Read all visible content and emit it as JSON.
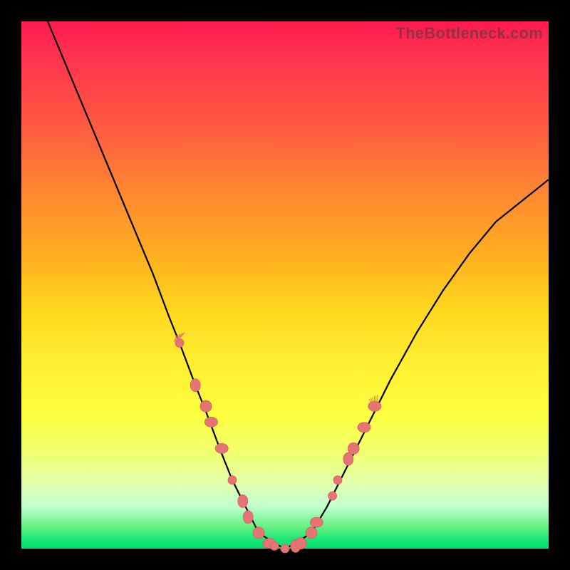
{
  "watermark": "TheBottleneck.com",
  "chart_data": {
    "type": "line",
    "title": "",
    "xlabel": "",
    "ylabel": "",
    "xlim": [
      0,
      100
    ],
    "ylim": [
      0,
      100
    ],
    "grid": false,
    "legend": false,
    "background_gradient": {
      "top_color": "#ff1a4d",
      "bottom_color": "#00e068",
      "description": "vertical red-to-green heat gradient"
    },
    "series": [
      {
        "name": "curve",
        "color": "#000000",
        "x": [
          5,
          10,
          15,
          20,
          25,
          28,
          30,
          33,
          35,
          38,
          40,
          43,
          45,
          48,
          50,
          52,
          55,
          58,
          60,
          65,
          70,
          75,
          80,
          85,
          90,
          95,
          100
        ],
        "values": [
          100,
          88,
          76,
          64,
          52,
          44,
          39,
          31,
          26,
          18,
          13,
          7,
          3,
          1,
          0,
          1,
          3,
          8,
          12,
          22,
          32,
          41,
          49,
          56,
          62,
          66,
          70
        ]
      }
    ],
    "markers": [
      {
        "x": 30,
        "y": 39
      },
      {
        "x": 33,
        "y": 31
      },
      {
        "x": 35,
        "y": 27
      },
      {
        "x": 36,
        "y": 24
      },
      {
        "x": 38,
        "y": 19
      },
      {
        "x": 40,
        "y": 13
      },
      {
        "x": 42,
        "y": 9
      },
      {
        "x": 43,
        "y": 6
      },
      {
        "x": 45,
        "y": 3
      },
      {
        "x": 47,
        "y": 1
      },
      {
        "x": 48,
        "y": 0.5
      },
      {
        "x": 50,
        "y": 0
      },
      {
        "x": 52,
        "y": 0.5
      },
      {
        "x": 53,
        "y": 1
      },
      {
        "x": 55,
        "y": 3
      },
      {
        "x": 56,
        "y": 5
      },
      {
        "x": 59,
        "y": 10
      },
      {
        "x": 60,
        "y": 13
      },
      {
        "x": 62,
        "y": 17
      },
      {
        "x": 63,
        "y": 19
      },
      {
        "x": 65,
        "y": 23
      },
      {
        "x": 67,
        "y": 27
      }
    ]
  }
}
